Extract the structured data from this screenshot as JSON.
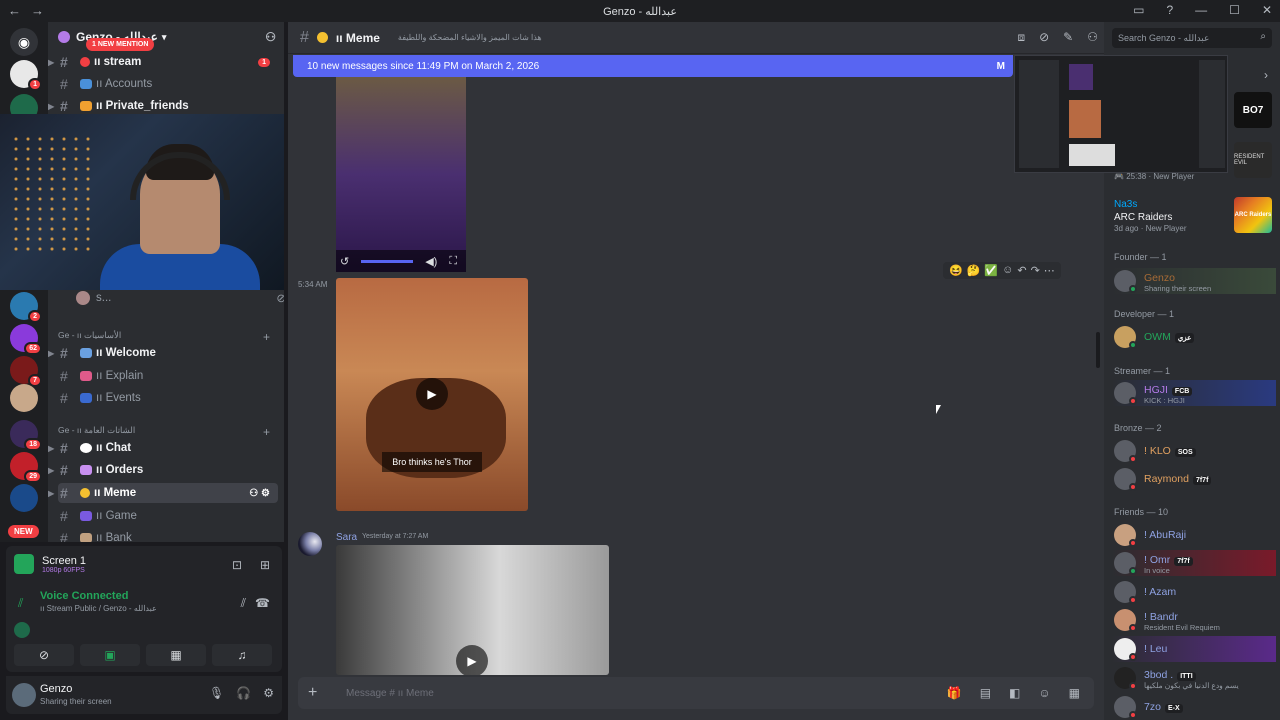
{
  "window": {
    "title": "Genzo - عبدالله"
  },
  "server": {
    "name": "Genzo - عبدالله",
    "mention_pill": "1 NEW MENTION",
    "new_pill": "NEW",
    "rail_badges": [
      "1",
      "2",
      "62",
      "7",
      "18",
      "29"
    ]
  },
  "channels": [
    {
      "name": "ıı stream",
      "unread": "1"
    },
    {
      "name": "ıı Accounts"
    },
    {
      "name": "ıı Private_friends"
    },
    {
      "name": "s..."
    }
  ],
  "categories": {
    "a": "Ge - ıı الأساسيات",
    "b": "Ge - ıı الشاتات العامة"
  },
  "channels2": [
    {
      "name": "ıı Welcome"
    },
    {
      "name": "ıı Explain"
    },
    {
      "name": "ıı Events"
    },
    {
      "name": "ıı Chat"
    },
    {
      "name": "ıı Orders"
    },
    {
      "name": "ıı Meme"
    },
    {
      "name": "ıı Game"
    },
    {
      "name": "ıı Bank"
    }
  ],
  "voice": {
    "screen_title": "Screen 1",
    "screen_sub": "1080p 60FPS",
    "connected": "Voice Connected",
    "channel": "ıı Stream Public / Genzo - عبدالله"
  },
  "user": {
    "name": "Genzo",
    "status": "Sharing their screen"
  },
  "chat": {
    "channel": "ıı Meme",
    "topic": "هذا شات الميمز والاشياء المضحكة واللطيفة",
    "banner": "10 new messages since 11:49 PM on March 2, 2026",
    "banner_right": "M",
    "timestamp": "5:34 AM",
    "caption": "Bro thinks he's Thor",
    "author2": "Sara",
    "author2_time": "Yesterday at 7:27 AM",
    "placeholder": "Message # ıı Meme"
  },
  "members": {
    "search_placeholder": "Search Genzo - عبدالله",
    "activity1_time": "25:38",
    "activity1_sub": "New Player",
    "activity2_user": "Na3s",
    "activity2_game": "ARC Raiders",
    "activity2_sub": "3d ago",
    "activity2_tag": "New Player",
    "game_labels": [
      "BO7",
      "RESIDENT EVIL",
      "ARC Raiders"
    ],
    "groups": [
      {
        "title": "Founder — 1",
        "members": [
          {
            "name": "Genzo",
            "status": "Sharing their screen",
            "color": "#a86b36"
          }
        ]
      },
      {
        "title": "Developer — 1",
        "members": [
          {
            "name": "OWM",
            "tag": "عزي",
            "color": "#23a55a"
          }
        ]
      },
      {
        "title": "Streamer — 1",
        "members": [
          {
            "name": "HGJI",
            "tag": "FCB",
            "status": "KICK : HGJI",
            "color": "#b47be8"
          }
        ]
      },
      {
        "title": "Bronze — 2",
        "members": [
          {
            "name": "! KLO",
            "tag": "SOS",
            "color": "#e0a060"
          },
          {
            "name": "Raymond",
            "tag": "7f7f",
            "color": "#e0a060"
          }
        ]
      },
      {
        "title": "Friends — 10",
        "members": [
          {
            "name": "! AbuRaji",
            "color": "#8ea1e1"
          },
          {
            "name": "! Omr",
            "tag": "7f7f",
            "status": "In voice",
            "color": "#8ea1e1"
          },
          {
            "name": "! Azam",
            "color": "#8ea1e1"
          },
          {
            "name": "! Bandr",
            "status": "Resident Evil Requiem",
            "color": "#8ea1e1"
          },
          {
            "name": "! Leu",
            "color": "#8ea1e1"
          },
          {
            "name": "3bod .",
            "tag": "ITTI",
            "status": "يسم ودع الدنيا في بكون ملكيها",
            "color": "#8ea1e1"
          },
          {
            "name": "7zo",
            "tag": "E-X",
            "color": "#8ea1e1"
          }
        ]
      }
    ]
  }
}
